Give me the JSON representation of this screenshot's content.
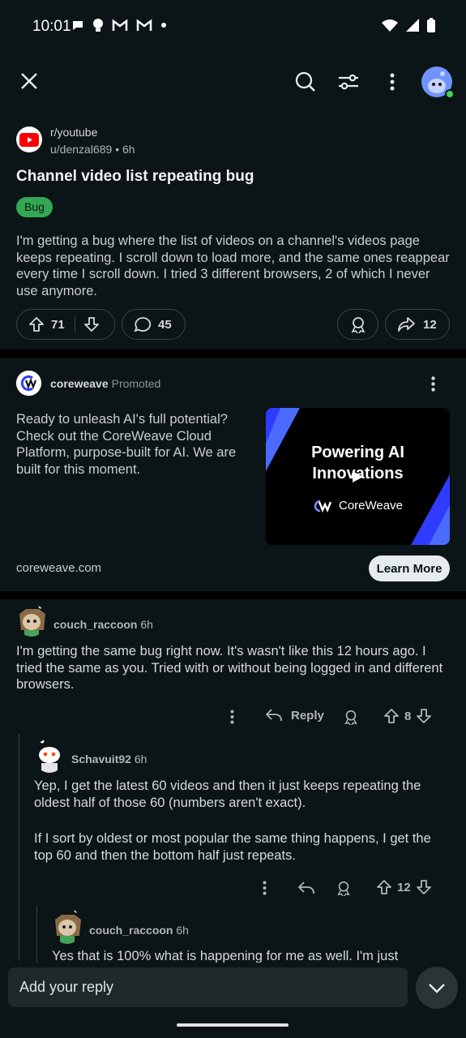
{
  "status_bar": {
    "time": "10:01"
  },
  "post": {
    "subreddit": "r/youtube",
    "author": "u/denzal689",
    "age": "6h",
    "title": "Channel video list repeating bug",
    "flair": "Bug",
    "body": "I'm getting a bug where the list of videos on a channel's videos page keeps repeating. I scroll down to load more, and the same ones reappear every time I scroll down. I tried 3 different browsers, 2 of which I never use anymore.",
    "upvotes": "71",
    "comments": "45",
    "shares": "12"
  },
  "ad": {
    "advertiser": "coreweave",
    "promoted_label": "Promoted",
    "text": "Ready to unleash AI's full potential? Check out the CoreWeave Cloud Platform, purpose-built for AI. We are built for this moment.",
    "image_title": "Powering AI Innovations",
    "image_brand": "CoreWeave",
    "domain": "coreweave.com",
    "cta": "Learn More"
  },
  "comments": [
    {
      "user": "couch_raccoon",
      "age": "6h",
      "text": "I'm getting the same bug right now. It's wasn't like this 12 hours ago. I tried the same as you. Tried with or without being logged in and different browsers.",
      "reply_label": "Reply",
      "votes": "8"
    },
    {
      "user": "Schavuit92",
      "age": "6h",
      "text_p1": "Yep, I get the latest 60 videos and then it just keeps repeating the oldest half of those 60 (numbers aren't exact).",
      "text_p2": "If I sort by oldest or most popular the same thing happens, I get the top 60 and then the bottom half just repeats.",
      "votes": "12"
    },
    {
      "user": "couch_raccoon",
      "age": "6h",
      "text": "Yes that is 100% what is happening for me as well. I'm just"
    }
  ],
  "reply_bar": {
    "placeholder": "Add your reply"
  },
  "colors": {
    "background": "#0b1416",
    "flair": "#32a852",
    "online": "#46d160",
    "youtube_red": "#ff0000"
  }
}
